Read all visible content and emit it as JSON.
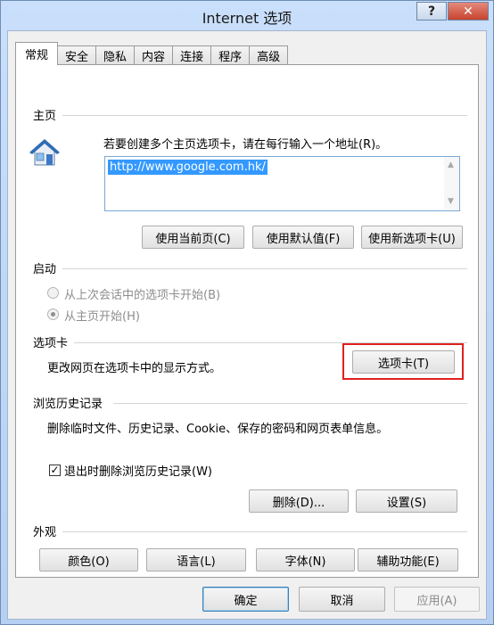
{
  "window": {
    "title": "Internet 选项",
    "help": "?",
    "close": "✕"
  },
  "tabs": [
    "常规",
    "安全",
    "隐私",
    "内容",
    "连接",
    "程序",
    "高级"
  ],
  "home": {
    "group": "主页",
    "instruction": "若要创建多个主页选项卡，请在每行输入一个地址(R)。",
    "url": "http://www.google.com.hk/",
    "buttons": {
      "current": "使用当前页(C)",
      "default": "使用默认值(F)",
      "newtab": "使用新选项卡(U)"
    }
  },
  "startup": {
    "group": "启动",
    "option_last": "从上次会话中的选项卡开始(B)",
    "option_home": "从主页开始(H)",
    "selected": "option_home"
  },
  "tabs_group": {
    "group": "选项卡",
    "desc": "更改网页在选项卡中的显示方式。",
    "button": "选项卡(T)"
  },
  "history": {
    "group": "浏览历史记录",
    "desc": "删除临时文件、历史记录、Cookie、保存的密码和网页表单信息。",
    "checkbox": "退出时删除浏览历史记录(W)",
    "checked": true,
    "delete": "删除(D)...",
    "settings": "设置(S)"
  },
  "appearance": {
    "group": "外观",
    "colors": "颜色(O)",
    "languages": "语言(L)",
    "fonts": "字体(N)",
    "accessibility": "辅助功能(E)"
  },
  "footer": {
    "ok": "确定",
    "cancel": "取消",
    "apply": "应用(A)"
  },
  "colors": {
    "highlight": "#e0201f",
    "selection": "#3399ff"
  }
}
